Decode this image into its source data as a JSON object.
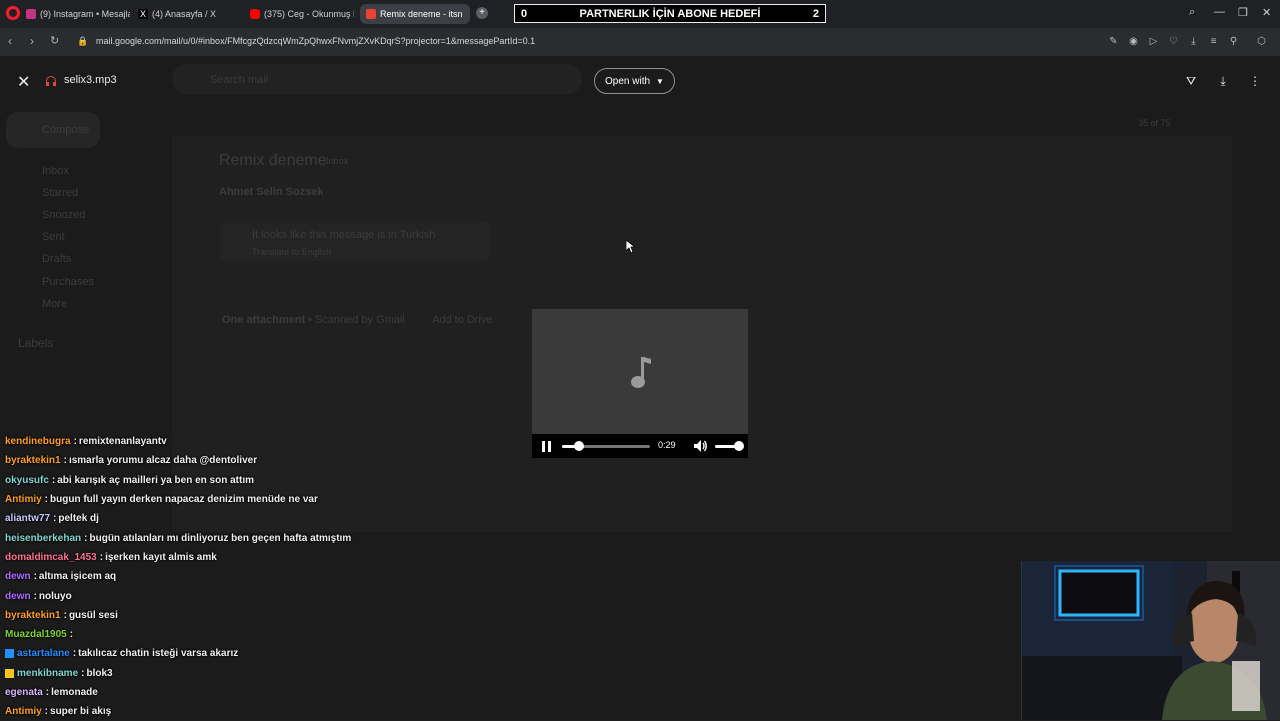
{
  "browser": {
    "tabs": [
      {
        "label": "(9) Instagram • Mesajlar",
        "color": "#c13584"
      },
      {
        "label": "(4) Anasayfa / X",
        "color": "#ffffff"
      },
      {
        "label": "(375) Ceg - Okunmuş Pir",
        "color": "#ff0000"
      },
      {
        "label": "Remix deneme - itsn",
        "color": "#ea4335",
        "active": true
      }
    ],
    "new_tab": "+",
    "banner": {
      "left": "0",
      "title": "PARTNERLIK İÇİN ABONE HEDEFİ",
      "right": "2"
    },
    "url": "mail.google.com/mail/u/0/#inbox/FMfcgzQdzcqWmZpQhwxFNvmjZXvKDqrS?projector=1&messagePartId=0.1"
  },
  "viewer": {
    "file_name": "selix3.mp3",
    "open_with": "Open with",
    "player": {
      "time": "0:29",
      "progress": 0.19,
      "volume": 1.0
    }
  },
  "gmail_bg": {
    "search": "Search mail",
    "compose": "Compose",
    "nav": [
      "Inbox",
      "Starred",
      "Snoozed",
      "Sent",
      "Drafts",
      "Purchases",
      "More"
    ],
    "labels": "Labels",
    "subject": "Remix deneme",
    "inbox_tag": "Inbox",
    "sender": "Ahmet Selin Sozsek",
    "translate_notice": "It looks like this message is in Turkish",
    "translate_sub": "Translate to English",
    "attachment": "One attachment",
    "scanned": "• Scanned by Gmail",
    "add_drive": "Add to Drive",
    "counter": "35 of 75"
  },
  "chat": [
    {
      "user": "kendinebugra",
      "color": "#ff9f1a",
      "text": "remixtenanlayantv"
    },
    {
      "user": "byraktekin1",
      "color": "#ff9f1a",
      "text": "ısmarla yorumu alcaz daha @dentoliver"
    },
    {
      "user": "okyusufc",
      "color": "#7ed7d2",
      "text": "abi karışık aç mailleri ya ben en son attım"
    },
    {
      "user": "Antimiy",
      "color": "#ff9f1a",
      "text": "bugun full yayın derken napacaz denizim menüde ne var"
    },
    {
      "user": "aliantw77",
      "color": "#c9c9ff",
      "text": "peltek dj"
    },
    {
      "user": "heisenberkehan",
      "color": "#7ed7d2",
      "text": "bugün atılanları mı dinliyoruz ben geçen hafta atmıştım"
    },
    {
      "user": "domaldimcak_1453",
      "color": "#ff6f91",
      "text": "işerken kayıt almis amk"
    },
    {
      "user": "dewn",
      "color": "#b069ff",
      "text": "altıma işicem aq"
    },
    {
      "user": "dewn",
      "color": "#b069ff",
      "text": "noluyo"
    },
    {
      "user": "byraktekin1",
      "color": "#ff9f1a",
      "text": "gusül sesi"
    },
    {
      "user": "Muazdal1905",
      "color": "#7ed321",
      "text": ""
    },
    {
      "user": "astartalane",
      "color": "#1e90ff",
      "text": "takılıcaz chatin isteği varsa akarız",
      "badge": "#1e90ff"
    },
    {
      "user": "menkibname",
      "color": "#7ed7d2",
      "text": "blok3",
      "badge": "#f5c518"
    },
    {
      "user": "egenata",
      "color": "#d8b4ff",
      "text": "lemonade"
    },
    {
      "user": "Antimiy",
      "color": "#ff9f1a",
      "text": "super bi akış"
    }
  ]
}
